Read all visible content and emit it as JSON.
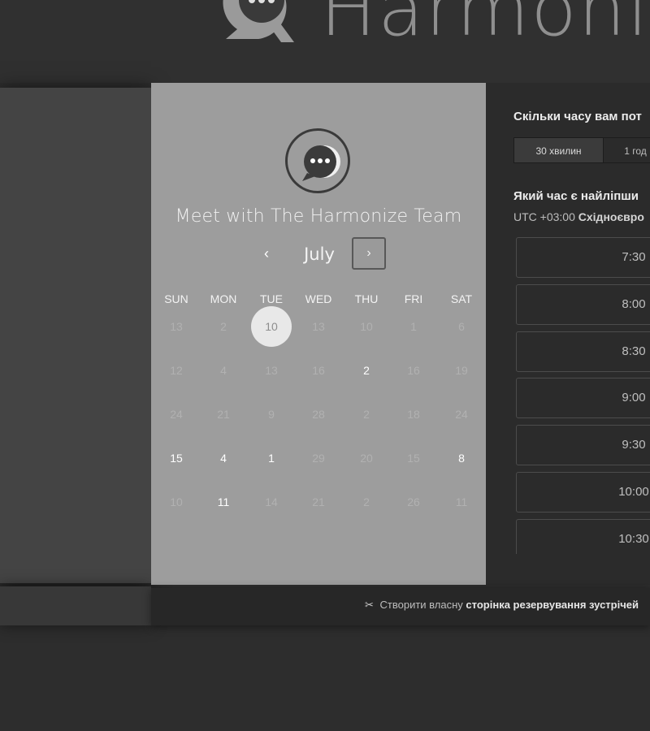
{
  "brand": {
    "name": "Harmoni"
  },
  "left_panel": {
    "title": "Meet with The Harmonize Team",
    "month": "July",
    "prev_icon": "‹",
    "next_icon": "›",
    "weekdays": [
      "SUN",
      "MON",
      "TUE",
      "WED",
      "THU",
      "FRI",
      "SAT"
    ],
    "days": [
      [
        "13",
        "2",
        "10",
        "13",
        "10",
        "1",
        "6"
      ],
      [
        "12",
        "4",
        "13",
        "16",
        "2",
        "16",
        "19"
      ],
      [
        "24",
        "21",
        "9",
        "28",
        "2",
        "18",
        "24"
      ],
      [
        "15",
        "4",
        "1",
        "29",
        "20",
        "15",
        "8"
      ],
      [
        "10",
        "11",
        "14",
        "21",
        "2",
        "26",
        "11"
      ]
    ],
    "available": [
      [
        1,
        4
      ],
      [
        3,
        0
      ],
      [
        3,
        1
      ],
      [
        3,
        2
      ],
      [
        3,
        6
      ],
      [
        4,
        1
      ]
    ],
    "selected": [
      0,
      2
    ]
  },
  "right_panel": {
    "duration_question": "Скільки часу вам пот",
    "durations": [
      "30 хвилин",
      "1 год"
    ],
    "time_question": "Який час є найліпши",
    "timezone_offset": "UTC +03:00",
    "timezone_name": "Східноєвро",
    "slots": [
      "7:30",
      "8:00",
      "8:30",
      "9:00",
      "9:30",
      "10:00",
      "10:30"
    ]
  },
  "footer": {
    "icon": "scissors-icon",
    "text_plain": "Створити власну",
    "text_bold": "сторінка резервування зустрічей"
  }
}
